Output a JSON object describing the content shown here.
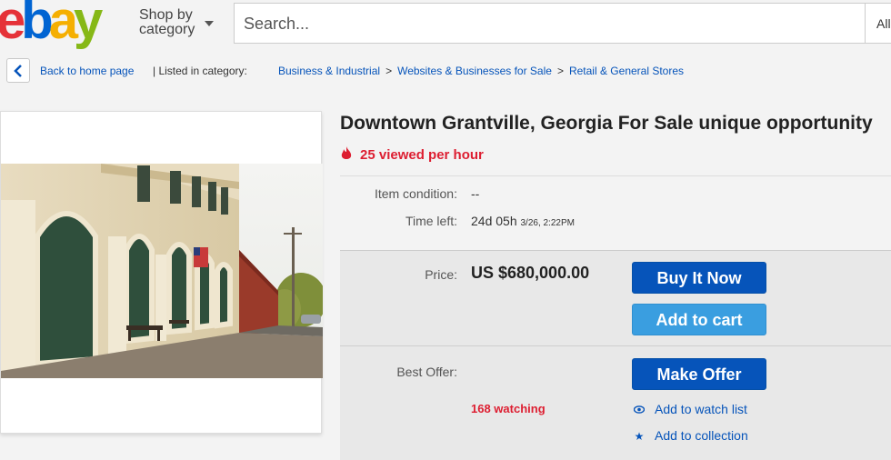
{
  "header": {
    "logo": {
      "e": "e",
      "b": "b",
      "a": "a",
      "y": "y"
    },
    "shop_by_line1": "Shop by",
    "shop_by_line2": "category",
    "search_placeholder": "Search...",
    "category_select": "All"
  },
  "breadcrumb": {
    "back_label": "Back to home page",
    "listed_label": "| Listed in category:",
    "items": [
      "Business & Industrial",
      "Websites & Businesses for Sale",
      "Retail & General Stores"
    ],
    "separator": ">"
  },
  "listing": {
    "title": "Downtown Grantville, Georgia For Sale unique opportunity",
    "views": "25 viewed per hour",
    "condition_label": "Item condition:",
    "condition_value": "--",
    "time_label": "Time left:",
    "time_value": "24d 05h",
    "time_end": "3/26, 2:22PM",
    "price_label": "Price:",
    "price_value": "US $680,000.00",
    "buy_now_label": "Buy It Now",
    "add_cart_label": "Add to cart",
    "best_offer_label": "Best Offer:",
    "make_offer_label": "Make Offer",
    "watching": "168 watching",
    "watch_list_label": "Add to watch list",
    "collection_label": "Add to collection"
  },
  "colors": {
    "link": "#0654ba",
    "accent_red": "#dd1e31",
    "button_blue": "#0654ba",
    "button_light_blue": "#3a9ee0"
  },
  "icons": [
    "chevron-left-icon",
    "caret-down-icon",
    "flame-icon",
    "eye-icon",
    "star-icon"
  ]
}
